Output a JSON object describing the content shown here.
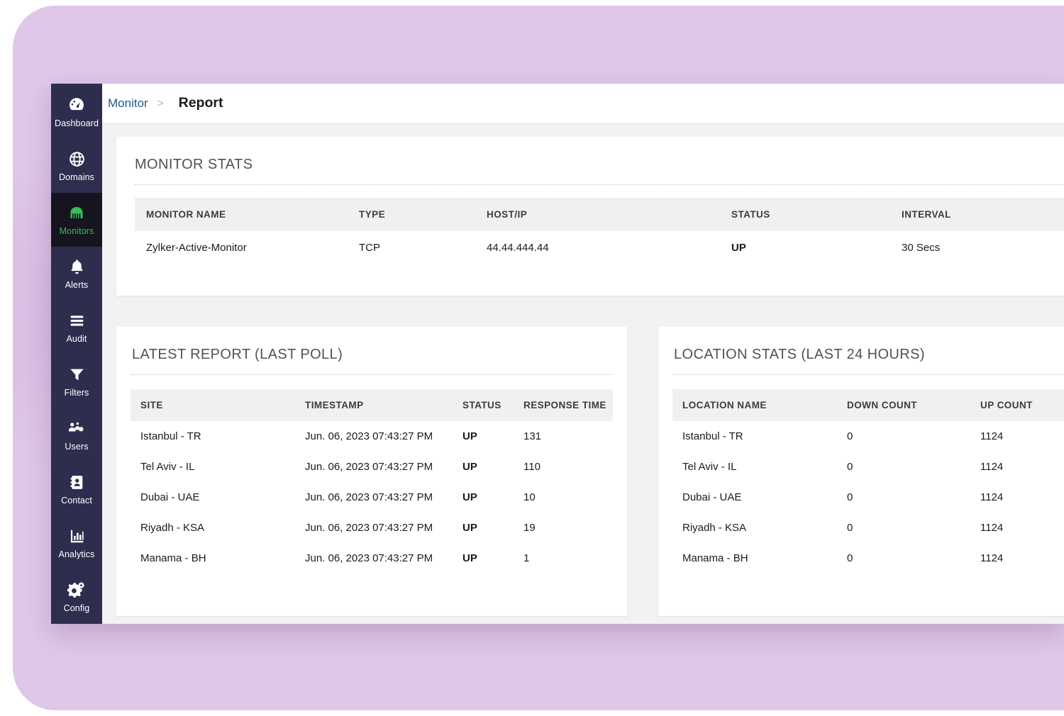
{
  "theme": {
    "page_background": "#dfc7e8",
    "sidebar_background": "#2e2d4e",
    "sidebar_active_background": "#16151f",
    "accent_green": "#3aba5e",
    "status_up_color": "#16a312",
    "link_blue": "#1c5c88",
    "table_header_background": "#f0f0f1",
    "content_background": "#f2f2f3"
  },
  "sidebar": {
    "items": [
      {
        "label": "Dashboard",
        "icon": "gauge-icon",
        "active": false
      },
      {
        "label": "Domains",
        "icon": "globe-icon",
        "active": false
      },
      {
        "label": "Monitors",
        "icon": "server-icon",
        "active": true
      },
      {
        "label": "Alerts",
        "icon": "bell-icon",
        "active": false
      },
      {
        "label": "Audit",
        "icon": "list-icon",
        "active": false
      },
      {
        "label": "Filters",
        "icon": "funnel-icon",
        "active": false
      },
      {
        "label": "Users",
        "icon": "users-gear-icon",
        "active": false
      },
      {
        "label": "Contact",
        "icon": "contact-card-icon",
        "active": false
      },
      {
        "label": "Analytics",
        "icon": "bar-chart-icon",
        "active": false
      },
      {
        "label": "Config",
        "icon": "gears-icon",
        "active": false
      }
    ]
  },
  "breadcrumb": {
    "root": "Monitor",
    "separator": ">",
    "leaf": "Report"
  },
  "monitor_stats": {
    "title": "MONITOR STATS",
    "columns": [
      "MONITOR NAME",
      "TYPE",
      "HOST/IP",
      "STATUS",
      "INTERVAL"
    ],
    "rows": [
      {
        "monitor_name": "Zylker-Active-Monitor",
        "type": "TCP",
        "host_ip": "44.44.444.44",
        "status": "UP",
        "interval": "30 Secs"
      }
    ]
  },
  "latest_report": {
    "title": "LATEST REPORT (LAST POLL)",
    "columns": [
      "SITE",
      "TIMESTAMP",
      "STATUS",
      "RESPONSE TIME"
    ],
    "rows": [
      {
        "site": "Istanbul - TR",
        "timestamp": "Jun. 06, 2023 07:43:27 PM",
        "status": "UP",
        "response_time": "131"
      },
      {
        "site": "Tel Aviv - IL",
        "timestamp": "Jun. 06, 2023 07:43:27 PM",
        "status": "UP",
        "response_time": "110"
      },
      {
        "site": "Dubai - UAE",
        "timestamp": "Jun. 06, 2023 07:43:27 PM",
        "status": "UP",
        "response_time": "10"
      },
      {
        "site": "Riyadh - KSA",
        "timestamp": "Jun. 06, 2023 07:43:27 PM",
        "status": "UP",
        "response_time": "19"
      },
      {
        "site": "Manama - BH",
        "timestamp": "Jun. 06, 2023 07:43:27 PM",
        "status": "UP",
        "response_time": "1"
      }
    ]
  },
  "location_stats": {
    "title": "LOCATION STATS (LAST 24 HOURS)",
    "columns": [
      "LOCATION NAME",
      "DOWN COUNT",
      "UP COUNT"
    ],
    "rows": [
      {
        "location_name": "Istanbul - TR",
        "down_count": "0",
        "up_count": "1124"
      },
      {
        "location_name": "Tel Aviv - IL",
        "down_count": "0",
        "up_count": "1124"
      },
      {
        "location_name": "Dubai - UAE",
        "down_count": "0",
        "up_count": "1124"
      },
      {
        "location_name": "Riyadh - KSA",
        "down_count": "0",
        "up_count": "1124"
      },
      {
        "location_name": "Manama - BH",
        "down_count": "0",
        "up_count": "1124"
      }
    ]
  }
}
